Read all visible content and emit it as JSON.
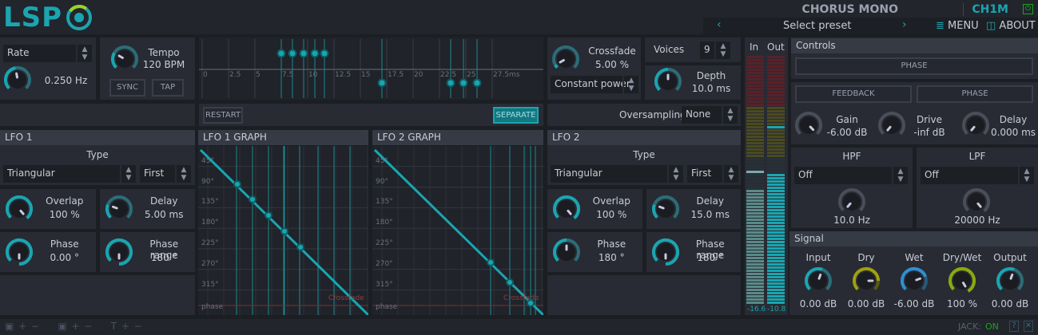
{
  "header": {
    "logo": "LSP",
    "plugin_name": "CHORUS MONO",
    "plugin_id": "CH1M",
    "preset": "Select preset",
    "prev": "‹",
    "next": "›",
    "menu": "MENU",
    "about": "ABOUT"
  },
  "rate": {
    "mode": "Rate",
    "value": "0.250 Hz"
  },
  "tempo": {
    "label": "Tempo",
    "value": "120 BPM",
    "sync": "SYNC",
    "tap": "TAP"
  },
  "delay_graph": {
    "ticks": [
      "0",
      "2.5",
      "5",
      "7.5",
      "10",
      "12.5",
      "15",
      "17.5",
      "20",
      "22.5",
      "25",
      "27.5ms"
    ],
    "restart": "RESTART",
    "separate": "SEPARATE"
  },
  "crossfade": {
    "label": "Crossfade",
    "value": "5.00 %",
    "mode": "Constant power"
  },
  "voices": {
    "label": "Voices",
    "value": "9"
  },
  "depth": {
    "label": "Depth",
    "value": "10.0 ms"
  },
  "oversampling": {
    "label": "Oversampling",
    "value": "None"
  },
  "lfo1": {
    "title": "LFO 1",
    "type_label": "Type",
    "type": "Triangular",
    "order": "First",
    "overlap_label": "Overlap",
    "overlap": "100 %",
    "delay_label": "Delay",
    "delay": "5.00 ms",
    "phase_label": "Phase",
    "phase": "0.00 °",
    "range_label": "Phase range",
    "range": "180 °"
  },
  "lfo2": {
    "title": "LFO 2",
    "type_label": "Type",
    "type": "Triangular",
    "order": "First",
    "overlap_label": "Overlap",
    "overlap": "100 %",
    "delay_label": "Delay",
    "delay": "15.0 ms",
    "phase_label": "Phase",
    "phase": "180 °",
    "range_label": "Phase range",
    "range": "180 °"
  },
  "graph1": {
    "title": "LFO 1 GRAPH",
    "ticks": [
      "45°",
      "90°",
      "135°",
      "180°",
      "225°",
      "270°",
      "315°"
    ],
    "xlabel": "phase",
    "crossfade": "Crossfade"
  },
  "graph2": {
    "title": "LFO 2 GRAPH",
    "ticks": [
      "45°",
      "90°",
      "135°",
      "180°",
      "225°",
      "270°",
      "315°"
    ],
    "xlabel": "phase",
    "crossfade": "Crossfade"
  },
  "meters": {
    "in_label": "In",
    "out_label": "Out",
    "in_value": "-16.6",
    "out_value": "-10.8"
  },
  "controls": {
    "title": "Controls",
    "phase_top": "PHASE",
    "feedback": "FEEDBACK",
    "phase": "PHASE",
    "gain_label": "Gain",
    "gain": "-6.00 dB",
    "drive_label": "Drive",
    "drive": "-inf dB",
    "delay_label": "Delay",
    "delay": "0.000 ms",
    "hpf_label": "HPF",
    "hpf_mode": "Off",
    "hpf": "10.0 Hz",
    "lpf_label": "LPF",
    "lpf_mode": "Off",
    "lpf": "20000 Hz"
  },
  "signal": {
    "title": "Signal",
    "input_label": "Input",
    "input": "0.00 dB",
    "dry_label": "Dry",
    "dry": "0.00 dB",
    "wet_label": "Wet",
    "wet": "-6.00 dB",
    "drywet_label": "Dry/Wet",
    "drywet": "100 %",
    "output_label": "Output",
    "output": "0.00 dB"
  },
  "footer": {
    "jack_label": "JACK:",
    "jack_state": "ON",
    "help": "?"
  },
  "colors": {
    "accent": "#1aa5b0",
    "dry": "#a0a010",
    "drywet": "#88aa10",
    "wet": "#2e8fd0",
    "grey": "#4a4e58"
  }
}
